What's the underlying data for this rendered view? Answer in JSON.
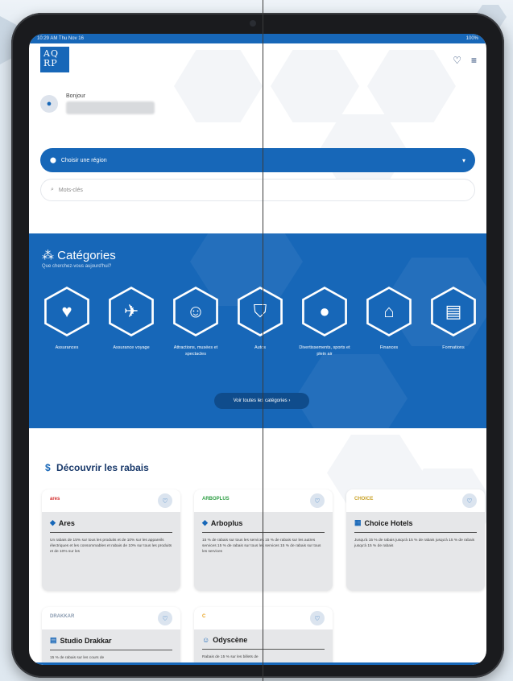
{
  "status": {
    "left": "10:29 AM   Thu Nov 16",
    "right": "100%"
  },
  "greeting": {
    "label": "Bonjour"
  },
  "region_button": {
    "label": "Choisir une région",
    "icon": "location-pin-icon"
  },
  "search": {
    "placeholder": "Mots-clés",
    "icon": "search-icon"
  },
  "categories": {
    "title": "Catégories",
    "subtitle": "Que cherchez-vous aujourd'hui?",
    "items": [
      {
        "label": "Assurances",
        "icon": "shield-heart-icon",
        "glyph": "♥"
      },
      {
        "label": "Assurance voyage",
        "icon": "shield-plane-icon",
        "glyph": "✈"
      },
      {
        "label": "Attractions, musées et spectacles",
        "icon": "theater-masks-icon",
        "glyph": "☺"
      },
      {
        "label": "Autos",
        "icon": "tags-icon",
        "glyph": "⛉"
      },
      {
        "label": "Divertissements, sports et plein air",
        "icon": "golf-ball-icon",
        "glyph": "●"
      },
      {
        "label": "Finances",
        "icon": "bank-icon",
        "glyph": "⌂"
      },
      {
        "label": "Formations",
        "icon": "book-icon",
        "glyph": "▤"
      }
    ],
    "button": "Voir toutes les catégories ›"
  },
  "deals": {
    "title": "Découvrir les rabais",
    "cards": [
      {
        "name": "Ares",
        "logo": "ares",
        "logo_color": "#d32f2f",
        "desc": "Un rabais de 15% sur tous les produits et de 10% sur les appareils électriques et les consommables et rabais de 10% sur tous les produits et de 10% sur les"
      },
      {
        "name": "Arboplus",
        "logo": "ARBOPLUS",
        "logo_color": "#2e9e44",
        "desc": "15 % de rabais sur tous les services 15 % de rabais sur les autres services 15 % de rabais sur tous les services 15 % de rabais sur tous les services"
      },
      {
        "name": "Choice Hotels",
        "logo": "CHOICE",
        "logo_color": "#c9a227",
        "desc": "Jusqu'à 15 % de rabais jusqu'à 15 % de rabais jusqu'à 15 % de rabais jusqu'à 15 % de rabais"
      },
      {
        "name": "Studio Drakkar",
        "logo": "DRAKKAR",
        "logo_color": "#8a9bb0",
        "desc": "15 % de rabais sur les cours de"
      },
      {
        "name": "Odyscène",
        "logo": "C",
        "logo_color": "#e8a320",
        "desc": "Rabais de 15 % sur les billets de"
      }
    ]
  },
  "colors": {
    "primary": "#1767b8",
    "dark": "#1a3a6b"
  }
}
